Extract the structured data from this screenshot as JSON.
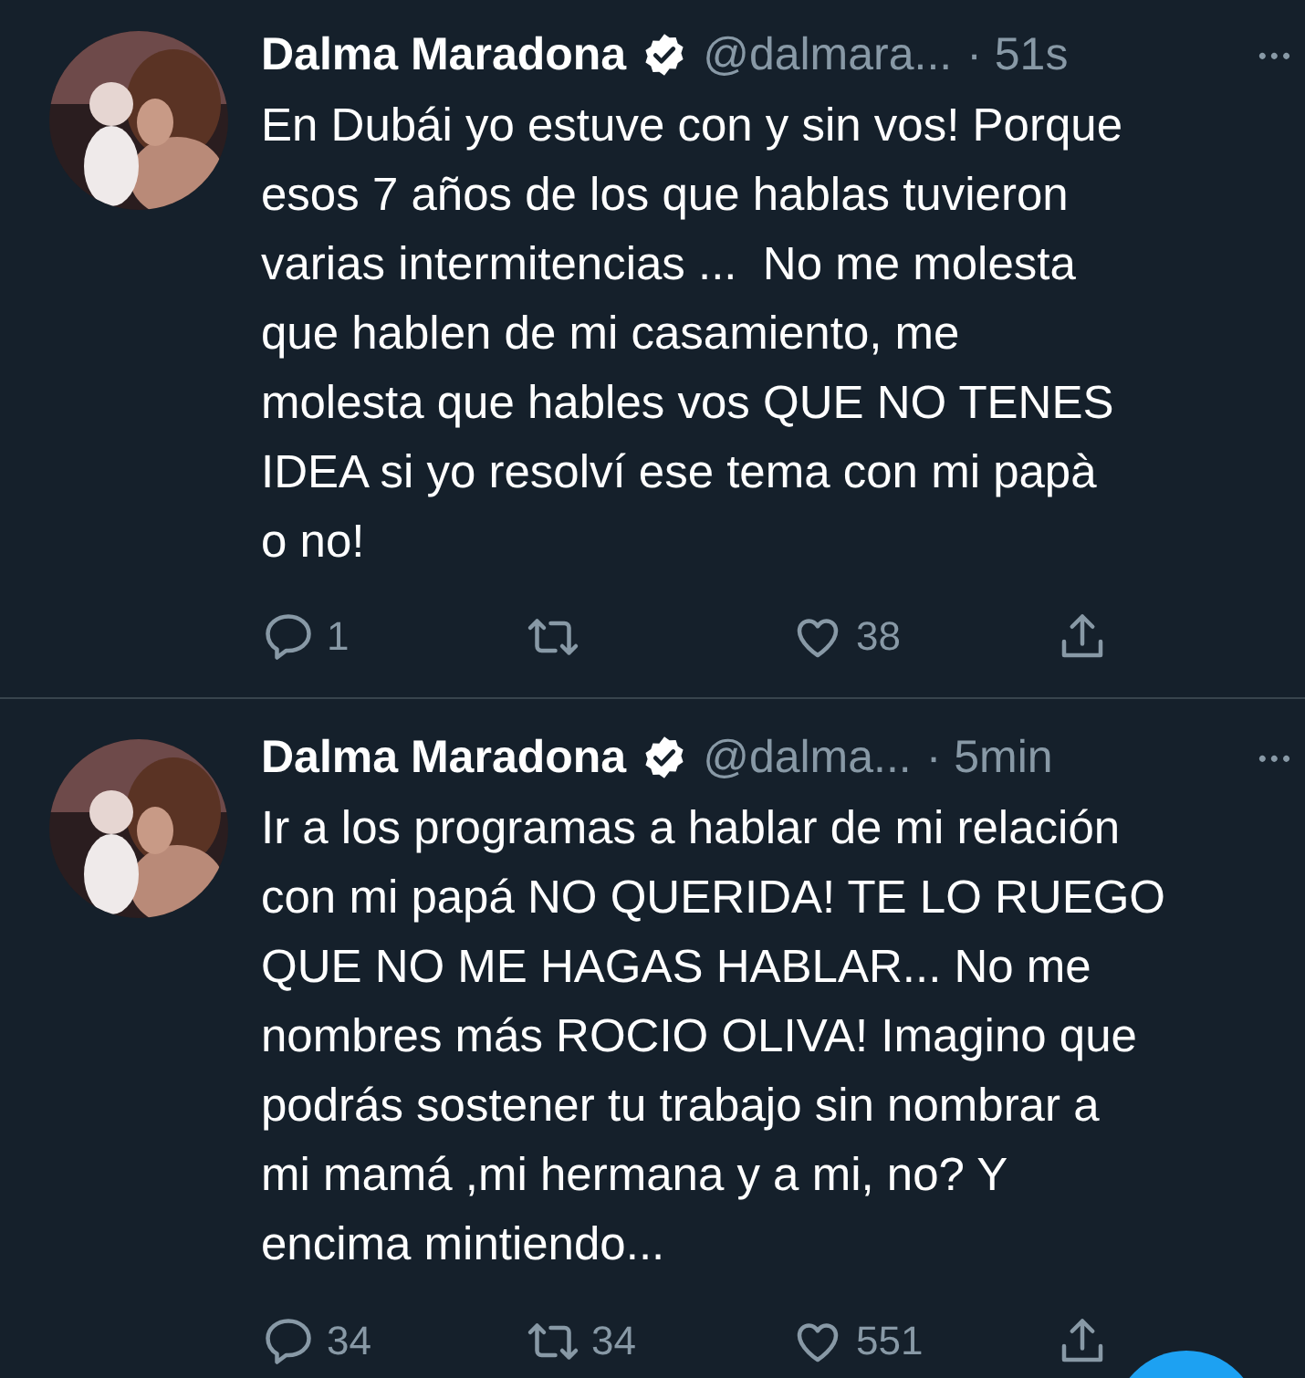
{
  "tweets": [
    {
      "name": "Dalma Maradona",
      "verified": true,
      "handle": "@dalmara...",
      "time": "· 51s",
      "more": "•••",
      "text": "En Dubái yo estuve con y sin vos! Porque\nesos 7 años de los que hablas tuvieron\nvarias intermitencias ...  No me molesta\nque hablen de mi casamiento, me\nmolesta que hables vos QUE NO TENES\nIDEA si yo resolví ese tema con mi papà\no no!",
      "replies": "1",
      "likes": "38"
    },
    {
      "name": "Dalma Maradona",
      "verified": true,
      "handle": "@dalma...",
      "time": "· 5min",
      "more": "•••",
      "text": "Ir a los programas a hablar de mi relación\ncon mi papá NO QUERIDA! TE LO RUEGO\nQUE NO ME HAGAS HABLAR... No me\nnombres más ROCIO OLIVA! Imagino que\npodrás sostener tu trabajo sin nombrar a\nmi mamá ,mi hermana y a mi, no? Y\nencima mintiendo...",
      "replies": "34",
      "retweets": "34",
      "likes": "551"
    }
  ]
}
